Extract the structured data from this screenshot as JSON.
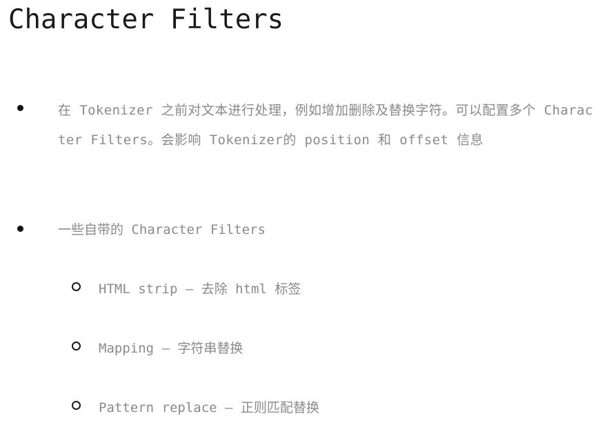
{
  "slide": {
    "title": "Character Filters",
    "bullets": [
      {
        "text": "在 Tokenizer 之前对文本进行处理，例如增加删除及替换字符。可以配置多个 Character Filters。会影响 Tokenizer的 position 和 offset 信息"
      },
      {
        "text": "一些自带的 Character Filters",
        "children": [
          {
            "text": "HTML strip – 去除 html 标签"
          },
          {
            "text": "Mapping – 字符串替换"
          },
          {
            "text": "Pattern replace – 正则匹配替换"
          }
        ]
      }
    ]
  }
}
